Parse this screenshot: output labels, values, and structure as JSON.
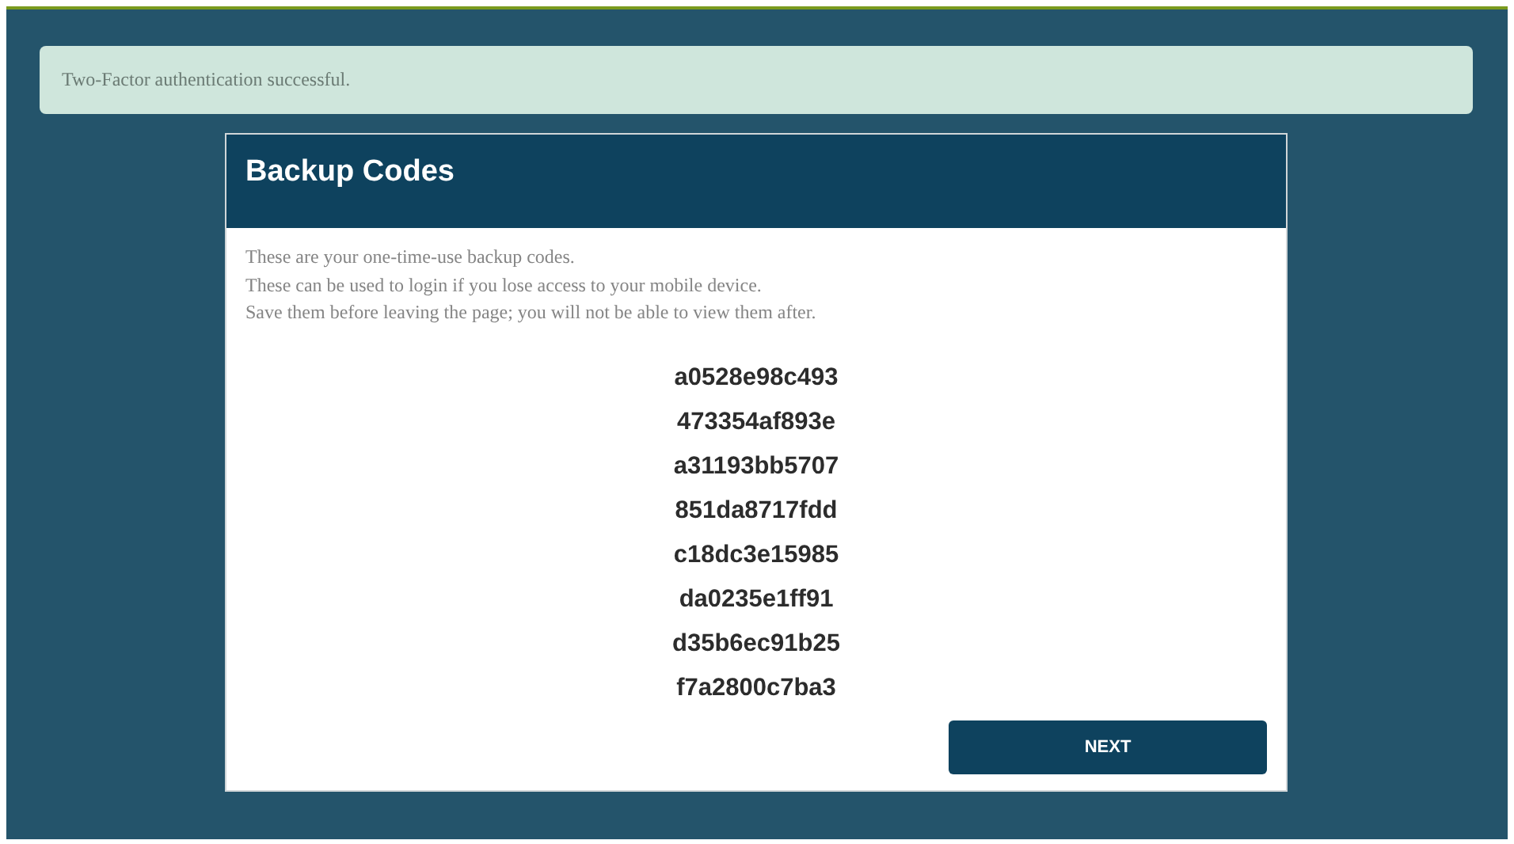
{
  "alert": {
    "message": "Two-Factor authentication successful."
  },
  "card": {
    "title": "Backup Codes",
    "intro_lines": [
      "These are your one-time-use backup codes.",
      "These can be used to login if you lose access to your mobile device.",
      "Save them before leaving the page; you will not be able to view them after."
    ],
    "codes": [
      "a0528e98c493",
      "473354af893e",
      "a31193bb5707",
      "851da8717fdd",
      "c18dc3e15985",
      "da0235e1ff91",
      "d35b6ec91b25",
      "f7a2800c7ba3"
    ],
    "button": "NEXT"
  }
}
